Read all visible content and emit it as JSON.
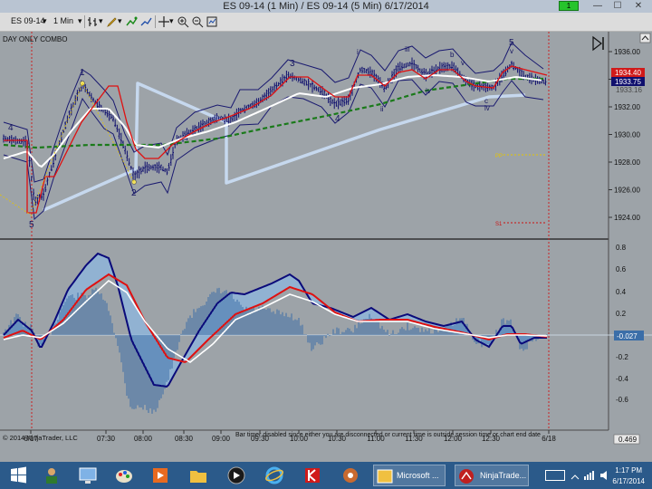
{
  "window": {
    "title": "ES 09-14 (1 Min) / ES 09-14 (5 Min)  6/17/2014",
    "status_indicator": "1",
    "minimize": "—",
    "maximize": "☐",
    "close": "✕"
  },
  "toolbar": {
    "instrument": "ES 09-14",
    "interval": "1 Min",
    "dropdown_glyph": "▾"
  },
  "chart": {
    "session_label": "DAY ONLY COMBO",
    "copyright": "© 2014 NinjaTrader, LLC",
    "bar_timer_msg": "Bar timer disabled since either you are disconnected or current time is outside session time or chart end date",
    "price_axis_ticks": [
      "1936.00",
      "1934.00",
      "1932.00",
      "1930.00",
      "1928.00",
      "1926.00",
      "1924.00"
    ],
    "price_badges": {
      "red": "1934.40",
      "blue": "1933.75",
      "gray": "1933.16"
    },
    "osc_axis_ticks": [
      "0.8",
      "0.6",
      "0.4",
      "0.2",
      "-0.2",
      "-0.4",
      "-0.6"
    ],
    "osc_badge": "-0.027",
    "osc_bottom_badge": "0.469",
    "time_ticks": [
      "6/17",
      "07:30",
      "08:00",
      "08:30",
      "09:00",
      "09:30",
      "10:00",
      "10:30",
      "11:00",
      "11:30",
      "12:00",
      "12:30",
      "6/18"
    ],
    "pivot_labels": {
      "pp": "PP",
      "s1": "S1"
    },
    "wave_labels": [
      "4",
      "5",
      "1",
      "2",
      "3",
      "4",
      "i",
      "ii",
      "iii",
      "iv",
      "b",
      "c",
      "v",
      "5",
      "iv",
      "v"
    ]
  },
  "taskbar": {
    "apps": [
      {
        "name": "windows-start",
        "label": ""
      },
      {
        "name": "microsoft-app",
        "label": "Microsoft ..."
      },
      {
        "name": "ninjatrader",
        "label": "NinjaTrade..."
      }
    ],
    "time": "1:17 PM",
    "date": "6/17/2014"
  },
  "colors": {
    "chart_bg": "#9da3a8",
    "price_bars": "#10106e",
    "red_line": "#e01010",
    "white_line": "#ffffff",
    "green_dashed": "#1a7a1a",
    "light_band": "#c6d8ee",
    "osc_fill": "#8eb7e0",
    "osc_hist": "#3b6ea8",
    "pivot": "#e5c400",
    "s1": "#cc1111"
  }
}
